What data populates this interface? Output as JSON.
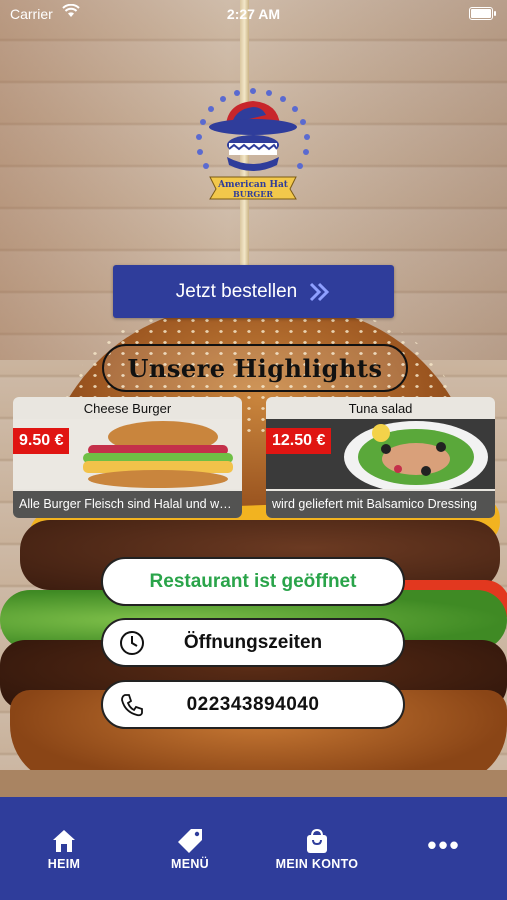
{
  "status_bar": {
    "carrier": "Carrier",
    "time": "2:27 AM"
  },
  "logo": {
    "line1": "American Hat",
    "line2": "BURGER"
  },
  "order_button": {
    "label": "Jetzt bestellen"
  },
  "highlights": {
    "heading": "Unsere Highlights",
    "items": [
      {
        "name": "Cheese Burger",
        "price": "9.50 €",
        "description": "Alle Burger Fleisch sind Halal und werde..."
      },
      {
        "name": "Tuna salad",
        "price": "12.50 €",
        "description": "wird geliefert mit Balsamico Dressing"
      }
    ]
  },
  "info": {
    "status": "Restaurant ist geöffnet",
    "hours_label": "Öffnungszeiten",
    "phone": "022343894040"
  },
  "tabbar": {
    "items": [
      {
        "label": "HEIM",
        "icon": "home-icon"
      },
      {
        "label": "MENÜ",
        "icon": "tag-icon"
      },
      {
        "label": "MEIN KONTO",
        "icon": "shopping-bag-icon"
      },
      {
        "label": "",
        "icon": "more-icon"
      }
    ]
  },
  "colors": {
    "brand": "#2f3d9b",
    "price": "#e01512",
    "open": "#2aa44a"
  }
}
